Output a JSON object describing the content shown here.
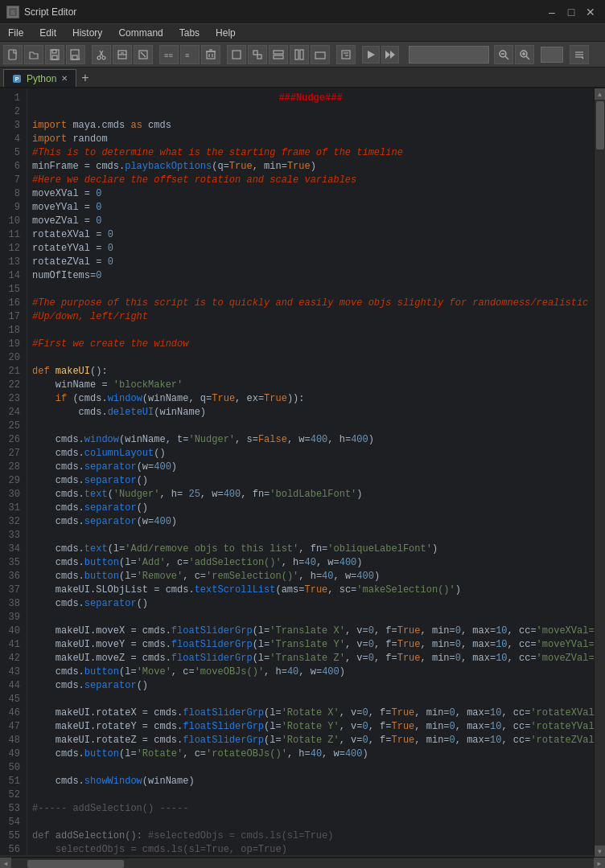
{
  "titleBar": {
    "icon": "SE",
    "title": "Script Editor",
    "minimizeLabel": "–",
    "maximizeLabel": "□",
    "closeLabel": "✕"
  },
  "menuBar": {
    "items": [
      "File",
      "Edit",
      "History",
      "Command",
      "Tabs",
      "Help"
    ]
  },
  "tabs": {
    "items": [
      {
        "label": "Python",
        "active": true
      }
    ],
    "addLabel": "+"
  },
  "statusBar": {}
}
